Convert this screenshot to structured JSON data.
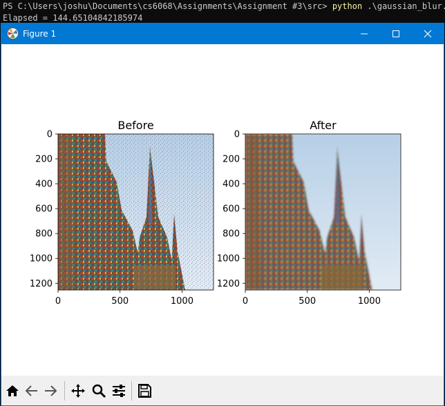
{
  "terminal": {
    "prompt": "PS C:\\Users\\joshu\\Documents\\cs6068\\Assignments\\Assignment #3\\src> ",
    "command": "python",
    "args": " .\\gaussian_blur.py",
    "output": "Elapsed = 144.65104842185974"
  },
  "window": {
    "title": "Figure 1",
    "accent": "#0078d4"
  },
  "plots": [
    {
      "title": "Before",
      "y_ticks": [
        "0",
        "200",
        "400",
        "600",
        "800",
        "1000",
        "1200"
      ],
      "x_ticks": [
        "0",
        "500",
        "1000"
      ]
    },
    {
      "title": "After",
      "y_ticks": [
        "0",
        "200",
        "400",
        "600",
        "800",
        "1000",
        "1200"
      ],
      "x_ticks": [
        "0",
        "500",
        "1000"
      ]
    }
  ],
  "toolbar": {
    "buttons": [
      "home-icon",
      "back-icon",
      "forward-icon",
      "pan-icon",
      "zoom-icon",
      "configure-subplots-icon",
      "save-icon"
    ]
  }
}
